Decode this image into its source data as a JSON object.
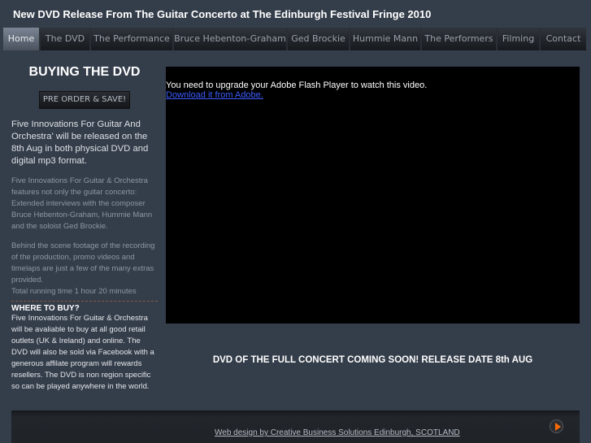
{
  "header": {
    "title": "New DVD Release From The Guitar Concerto at The Edinburgh Festival Fringe 2010"
  },
  "nav": [
    {
      "label": "Home",
      "active": true
    },
    {
      "label": "The DVD"
    },
    {
      "label": "The Performance"
    },
    {
      "label": "Bruce Hebenton-Graham"
    },
    {
      "label": "Ged Brockie"
    },
    {
      "label": "Hummie Mann"
    },
    {
      "label": "The Performers"
    },
    {
      "label": "Filming"
    },
    {
      "label": "Contact"
    }
  ],
  "sidebar": {
    "heading": "BUYING THE DVD",
    "button": "PRE ORDER & SAVE!",
    "intro": "Five Innovations For Guitar And Orchestra' will be released on the 8th Aug in both physical DVD and digital mp3 format.",
    "features": "Five Innovations For Guitar & Orchestra features not only the guitar concerto: Extended interviews with the composer Bruce Hebenton-Graham, Hummie Mann and the soloist Ged Brockie.",
    "extras": "Behind the scene footage of the recording of the production, promo videos and timelaps are just a few of the many extras provided.",
    "running_time": "Total running time 1 hour 20 minutes",
    "where_heading": "WHERE TO BUY?",
    "where_text": "Five Innovations For Guitar & Orchestra will be avaliable to buy at all good retail outlets (UK & Ireland) and online.  The DVD will also be sold via Facebook with a generous affilate program will rewards resellers. The DVD is non region specific so can be played anywhere in the world."
  },
  "video": {
    "message": "You need to upgrade your Adobe Flash Player to watch this video.",
    "link": "Download it from Adobe."
  },
  "main": {
    "coming_soon": "DVD OF THE FULL CONCERT COMING SOON! RELEASE DATE 8th AUG"
  },
  "footer": {
    "credit": "Web design by Creative Business Solutions Edinburgh, SCOTLAND",
    "play_icon": "play-icon",
    "accent": "#ff6a00"
  }
}
